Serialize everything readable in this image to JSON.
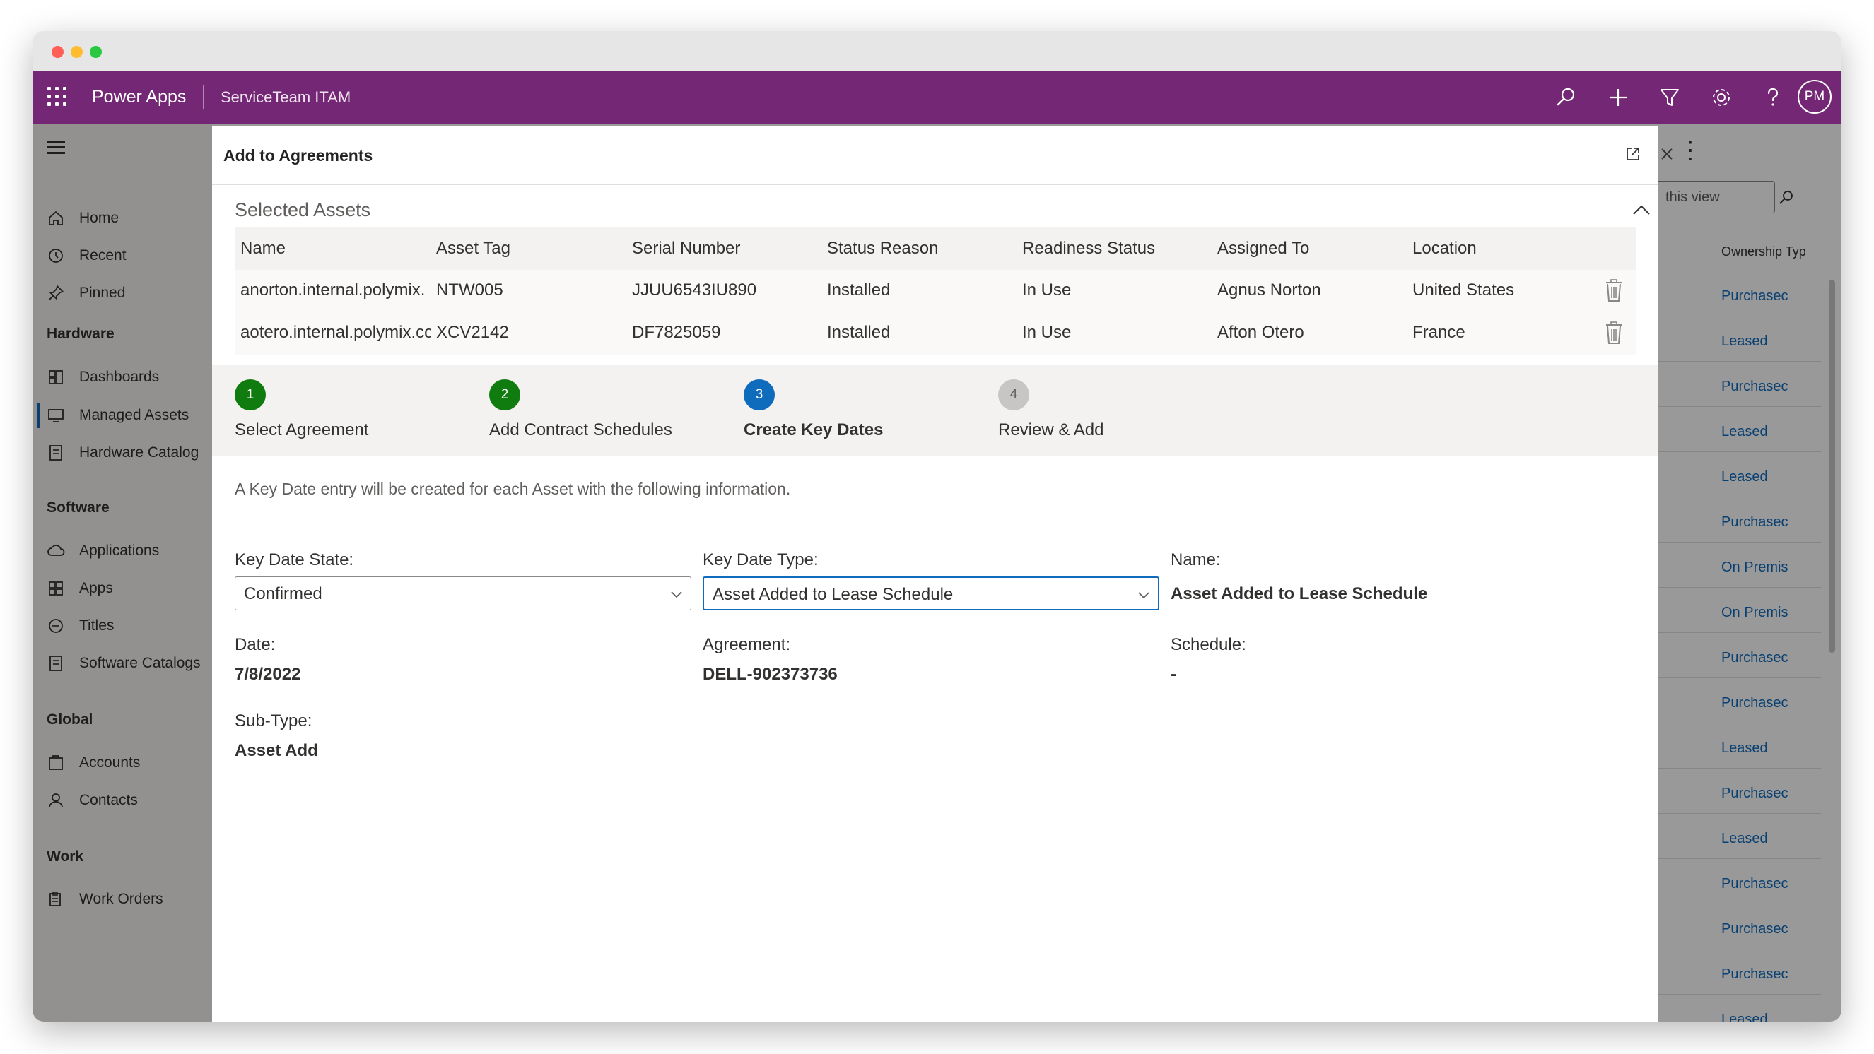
{
  "app": {
    "name": "Power Apps",
    "environment": "ServiceTeam ITAM",
    "user_initials": "PM"
  },
  "nav": {
    "items_top": [
      {
        "label": "Home",
        "icon": "home-icon"
      },
      {
        "label": "Recent",
        "icon": "clock-icon"
      },
      {
        "label": "Pinned",
        "icon": "pin-icon"
      }
    ],
    "groups": [
      {
        "title": "Hardware",
        "items": [
          {
            "label": "Dashboards",
            "icon": "dashboard-icon"
          },
          {
            "label": "Managed Assets",
            "icon": "device-icon",
            "active": true
          },
          {
            "label": "Hardware Catalog",
            "icon": "catalog-icon"
          }
        ]
      },
      {
        "title": "Software",
        "items": [
          {
            "label": "Applications",
            "icon": "cloud-icon"
          },
          {
            "label": "Apps",
            "icon": "apps-icon"
          },
          {
            "label": "Titles",
            "icon": "titles-icon"
          },
          {
            "label": "Software Catalogs",
            "icon": "catalog-icon"
          }
        ]
      },
      {
        "title": "Global",
        "items": [
          {
            "label": "Accounts",
            "icon": "accounts-icon"
          },
          {
            "label": "Contacts",
            "icon": "person-icon"
          }
        ]
      },
      {
        "title": "Work",
        "items": [
          {
            "label": "Work Orders",
            "icon": "work-orders-icon"
          }
        ]
      }
    ]
  },
  "background_grid": {
    "search_placeholder": "this view",
    "column_header": "Ownership Typ",
    "rows": [
      "Purchasec",
      "Leased",
      "Purchasec",
      "Leased",
      "Leased",
      "Purchasec",
      "On Premis",
      "On Premis",
      "Purchasec",
      "Purchasec",
      "Leased",
      "Purchasec",
      "Leased",
      "Purchasec",
      "Purchasec",
      "Purchasec",
      "Leased"
    ]
  },
  "dialog": {
    "title": "Add to Agreements",
    "selected_assets": {
      "title": "Selected Assets",
      "columns": [
        "Name",
        "Asset Tag",
        "Serial Number",
        "Status Reason",
        "Readiness Status",
        "Assigned To",
        "Location"
      ],
      "rows": [
        [
          "anorton.internal.polymix.",
          "NTW005",
          "JJUU6543IU890",
          "Installed",
          "In Use",
          "Agnus Norton",
          "United States"
        ],
        [
          "aotero.internal.polymix.cc",
          "XCV2142",
          "DF7825059",
          "Installed",
          "In Use",
          "Afton Otero",
          "France"
        ]
      ]
    },
    "steps": [
      {
        "number": "1",
        "label": "Select Agreement",
        "state": "completed"
      },
      {
        "number": "2",
        "label": "Add Contract Schedules",
        "state": "completed"
      },
      {
        "number": "3",
        "label": "Create Key Dates",
        "state": "current"
      },
      {
        "number": "4",
        "label": "Review & Add",
        "state": "pending"
      }
    ],
    "info_text": "A Key Date entry will be created for each Asset with the following information.",
    "form": {
      "key_date_state": {
        "label": "Key Date State:",
        "value": "Confirmed"
      },
      "key_date_type": {
        "label": "Key Date Type:",
        "value": "Asset Added to Lease Schedule"
      },
      "name": {
        "label": "Name:",
        "value": "Asset Added to Lease Schedule"
      },
      "date": {
        "label": "Date:",
        "value": "7/8/2022"
      },
      "agreement": {
        "label": "Agreement:",
        "value": "DELL-902373736"
      },
      "schedule": {
        "label": "Schedule:",
        "value": "-"
      },
      "sub_type": {
        "label": "Sub-Type:",
        "value": "Asset Add"
      }
    }
  },
  "colors": {
    "brand_purple": "#742774",
    "step_completed": "#107c10",
    "step_current": "#0f6cbd",
    "step_pending": "#c8c6c4",
    "link_blue": "#0f6cbd"
  }
}
